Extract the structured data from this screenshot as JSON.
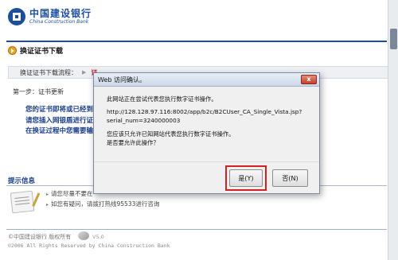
{
  "logo": {
    "cn": "中国建设银行",
    "en": "China Construction Bank"
  },
  "section_title": "换证证书下载",
  "flow": {
    "label": "换证证书下载流程：",
    "step_active": "证"
  },
  "step": "第一步：证书更新",
  "notices": [
    "您的证书即将或已经到",
    "请您插入网银盾进行证",
    "在换证过程中您需要输"
  ],
  "tips": {
    "title": "提示信息",
    "items": [
      "请您尽量不要在",
      "如您有疑问，请拨打热线95533进行咨询"
    ]
  },
  "footer": {
    "line1": "©中国建设银行 版权所有",
    "version": "V5.0",
    "line2": "©2006 All Rights Reserved by China Construction Bank"
  },
  "dialog": {
    "title": "Web 访问确认。",
    "close_label": "x",
    "text1": "此网站正在尝试代表您执行数字证书操作。",
    "url": "http://128.128.97.116:8002/app/b2c/B2CUser_CA_Single_Vista.jsp?serial_num=3240000003",
    "text2_line1": "您应该只允许已知网站代表您执行数字证书操作。",
    "text2_line2": "是否要允许此操作？",
    "yes_label": "是(Y)",
    "no_label": "否(N)"
  },
  "colors": {
    "brand_blue": "#1b4f9c",
    "highlight_red": "#d42020"
  }
}
